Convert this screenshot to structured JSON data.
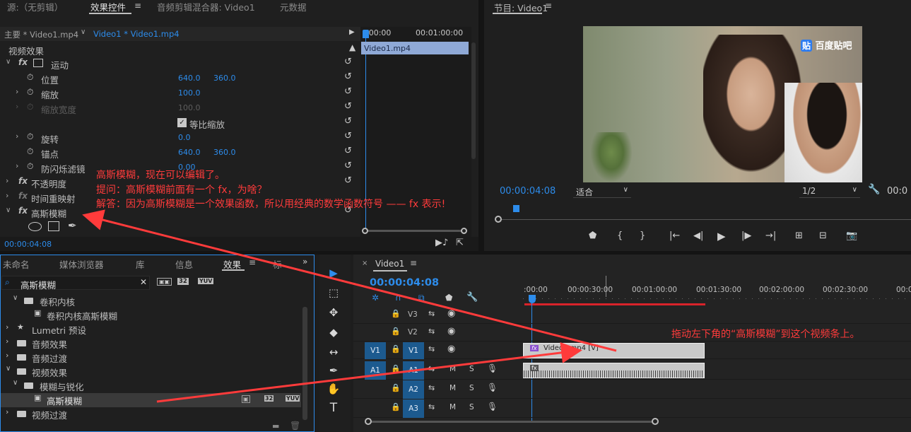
{
  "source_panel": {
    "tabs": [
      "源:（无剪辑）",
      "效果控件",
      "音频剪辑混合器: Video1",
      "元数据"
    ],
    "active_tab": "效果控件",
    "clip_tabs": [
      "主要 * Video1.mp4",
      "Video1 * Video1.mp4"
    ],
    "section": "视频效果",
    "mini_timeline": {
      "start": ":00:00",
      "end": "00:01:00:00",
      "clip": "Video1.mp4"
    },
    "effects": [
      {
        "name": "运动",
        "fx": "fx"
      },
      {
        "name": "位置",
        "v1": "640.0",
        "v2": "360.0"
      },
      {
        "name": "缩放",
        "v1": "100.0"
      },
      {
        "name": "缩放宽度",
        "v1": "100.0"
      },
      {
        "name": "等比缩放"
      },
      {
        "name": "旋转",
        "v1": "0.0"
      },
      {
        "name": "锚点",
        "v1": "640.0",
        "v2": "360.0"
      },
      {
        "name": "防闪烁滤镜",
        "v1": "0.00"
      },
      {
        "name": "不透明度",
        "fx": "fx"
      },
      {
        "name": "时间重映射",
        "fx": "fx"
      },
      {
        "name": "高斯模糊",
        "fx": "fx"
      }
    ],
    "timecode": "00:00:04:08"
  },
  "program_monitor": {
    "title": "节目: Video1",
    "watermark": "百度贴吧",
    "watermark_icon": "贴",
    "timecode": "00:00:04:08",
    "fit": "适合",
    "quality": "1/2",
    "right_time": "00:0"
  },
  "project_panel": {
    "tabs": [
      "未命名",
      "媒体浏览器",
      "库",
      "信息",
      "效果",
      "标"
    ],
    "active_tab": "效果",
    "search_value": "高斯模糊",
    "badges": [
      "32",
      "32",
      "YUV"
    ],
    "tree": [
      {
        "label": "卷积内核",
        "level": 1,
        "type": "folder",
        "open": true
      },
      {
        "label": "卷积内核高斯模糊",
        "level": 2,
        "type": "effect"
      },
      {
        "label": "Lumetri 预设",
        "level": 0,
        "type": "folder"
      },
      {
        "label": "音频效果",
        "level": 0,
        "type": "folder"
      },
      {
        "label": "音频过渡",
        "level": 0,
        "type": "folder"
      },
      {
        "label": "视频效果",
        "level": 0,
        "type": "folder",
        "open": true
      },
      {
        "label": "模糊与锐化",
        "level": 1,
        "type": "folder",
        "open": true
      },
      {
        "label": "高斯模糊",
        "level": 2,
        "type": "effect",
        "selected": true
      },
      {
        "label": "视频过渡",
        "level": 0,
        "type": "folder"
      }
    ]
  },
  "timeline": {
    "title": "Video1",
    "timecode": "00:00:04:08",
    "ruler": [
      ":00:00",
      "00:00:30:00",
      "00:01:00:00",
      "00:01:30:00",
      "00:02:00:00",
      "00:02:30:00",
      "00:03:"
    ],
    "tracks": [
      {
        "name": "V3"
      },
      {
        "name": "V2"
      },
      {
        "name": "V1",
        "src": "V1"
      },
      {
        "name": "A1",
        "src": "A1"
      },
      {
        "name": "A2"
      },
      {
        "name": "A3"
      }
    ],
    "video_clip": "Video1.mp4 [V]",
    "mute": "M",
    "solo": "S"
  },
  "annotations": {
    "line1": "高斯模糊，现在可以编辑了。",
    "line2": "提问：高斯模糊前面有一个 fx，为啥？",
    "line3": "解答：因为高斯模糊是一个效果函数，所以用经典的数学函数符号 —— fx 表示!",
    "timeline_note": "拖动左下角的“高斯模糊”到这个视频条上。"
  },
  "colors": {
    "accent": "#2d8ceb",
    "annotation": "#ff3b3b",
    "clip": "#c9c9c9"
  }
}
